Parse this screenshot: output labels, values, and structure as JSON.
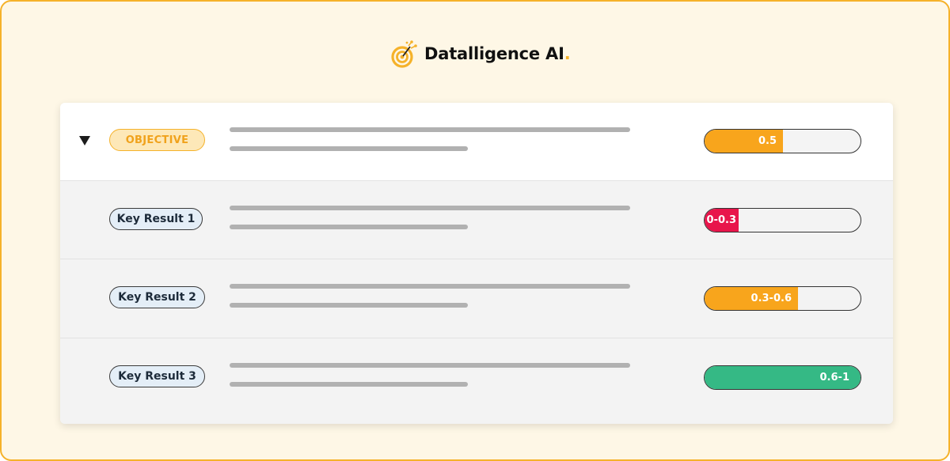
{
  "brand": {
    "name": "Datalligence AI",
    "dot": ".",
    "accent_color": "#f5b22a"
  },
  "objective": {
    "label": "OBJECTIVE",
    "progress_label": "0.5",
    "progress_fraction": 0.5,
    "progress_color": "#f8a51c"
  },
  "key_results": [
    {
      "label": "Key Result 1",
      "progress_label": "0-0.3",
      "progress_fraction": 0.22,
      "progress_color": "#e8154b"
    },
    {
      "label": "Key Result 2",
      "progress_label": "0.3-0.6",
      "progress_fraction": 0.6,
      "progress_color": "#f8a51c"
    },
    {
      "label": "Key Result 3",
      "progress_label": "0.6-1",
      "progress_fraction": 1.0,
      "progress_color": "#35b985"
    }
  ],
  "icons": {
    "collapse": "caret-down-icon",
    "logo": "target-icon"
  }
}
